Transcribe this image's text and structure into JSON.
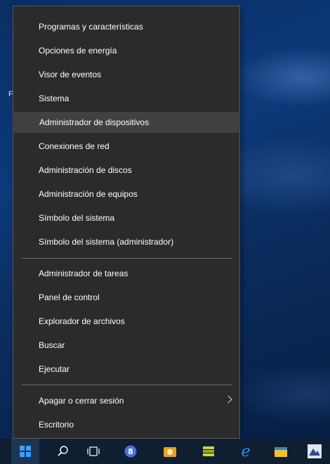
{
  "desktop": {
    "edge_letter": "F"
  },
  "menu": {
    "items": [
      {
        "label": "Programas y características"
      },
      {
        "label": "Opciones de energía"
      },
      {
        "label": "Visor de eventos"
      },
      {
        "label": "Sistema"
      },
      {
        "label": "Administrador de dispositivos",
        "highlighted": true
      },
      {
        "label": "Conexiones de red"
      },
      {
        "label": "Administración de discos"
      },
      {
        "label": "Administración de equipos"
      },
      {
        "label": "Símbolo del sistema"
      },
      {
        "label": "Símbolo del sistema (administrador)"
      },
      {
        "label": "Administrador de tareas"
      },
      {
        "label": "Panel de control"
      },
      {
        "label": "Explorador de archivos"
      },
      {
        "label": "Buscar"
      },
      {
        "label": "Ejecutar"
      },
      {
        "label": "Apagar o cerrar sesión",
        "has_submenu": true
      },
      {
        "label": "Escritorio"
      }
    ]
  },
  "taskbar": {
    "icons": [
      "windows-start-icon",
      "search-icon",
      "task-view-icon",
      "app-icon",
      "photo-icon",
      "archive-icon",
      "edge-icon",
      "file-explorer-icon",
      "mountain-app-icon"
    ]
  },
  "colors": {
    "menu_bg": "#2b2b2b",
    "highlight": "#414141",
    "taskbar": "#0f1e30",
    "accent": "#0078d7"
  }
}
